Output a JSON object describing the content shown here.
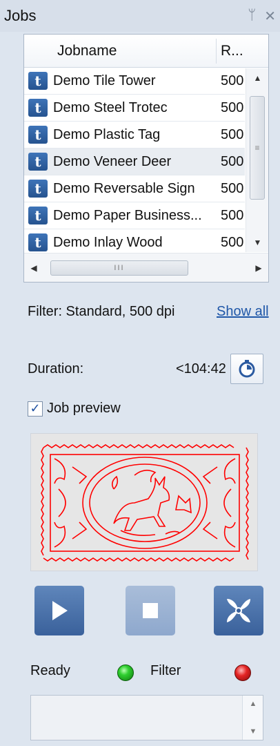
{
  "window": {
    "title": "Jobs",
    "pin_icon": "pin-icon",
    "close_icon": "close-icon",
    "pin_glyph": "ᛘ",
    "close_glyph": "✕"
  },
  "jobs_table": {
    "columns": [
      "Jobname",
      "R..."
    ],
    "rows": [
      {
        "name": "Demo Tile Tower",
        "res": "500"
      },
      {
        "name": "Demo Steel Trotec",
        "res": "500"
      },
      {
        "name": "Demo Plastic Tag",
        "res": "500"
      },
      {
        "name": "Demo Veneer Deer",
        "res": "500",
        "selected": true
      },
      {
        "name": "Demo Reversable Sign",
        "res": "500"
      },
      {
        "name": "Demo Paper Business...",
        "res": "500"
      },
      {
        "name": "Demo Inlay Wood",
        "res": "500"
      }
    ],
    "row_icon_glyph": "t",
    "row_icon": "trotec-job-icon"
  },
  "filter": {
    "label": "Filter: Standard, 500 dpi",
    "show_all": "Show all"
  },
  "duration": {
    "label": "Duration:",
    "value": "<104:42",
    "button_icon": "stopwatch-icon"
  },
  "preview": {
    "checkbox_label": "Job preview",
    "checked": true
  },
  "controls": {
    "play_icon": "play-icon",
    "stop_icon": "stop-icon",
    "fan_icon": "exhaust-fan-icon"
  },
  "status": {
    "ready_label": "Ready",
    "filter_label": "Filter",
    "ready_color": "#2fcf2f",
    "filter_color": "#e42424"
  },
  "colors": {
    "panel_bg": "#dde5ef",
    "accent": "#3a619b",
    "link": "#1f57a8",
    "preview_stroke": "#ff0000"
  }
}
